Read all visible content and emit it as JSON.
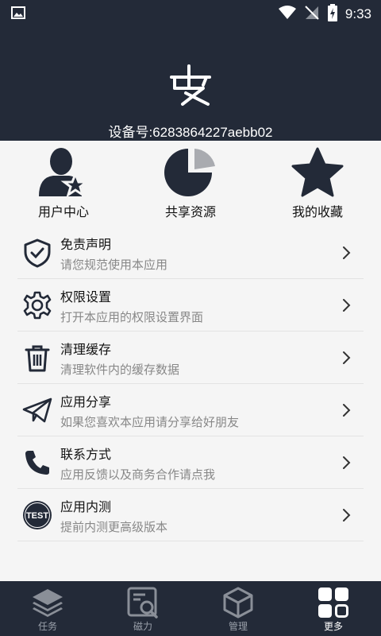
{
  "status": {
    "time": "9:33"
  },
  "header": {
    "logo_char": "皮",
    "device_id": "设备号:6283864227aebb02"
  },
  "quick": [
    {
      "label": "用户中心",
      "icon": "user-star-icon"
    },
    {
      "label": "共享资源",
      "icon": "pie-icon"
    },
    {
      "label": "我的收藏",
      "icon": "star-icon"
    }
  ],
  "menu": [
    {
      "title": "免责声明",
      "subtitle": "请您规范使用本应用",
      "icon": "shield-check-icon"
    },
    {
      "title": "权限设置",
      "subtitle": "打开本应用的权限设置界面",
      "icon": "gear-icon"
    },
    {
      "title": "清理缓存",
      "subtitle": "清理软件内的缓存数据",
      "icon": "trash-icon"
    },
    {
      "title": "应用分享",
      "subtitle": "如果您喜欢本应用请分享给好朋友",
      "icon": "send-icon"
    },
    {
      "title": "联系方式",
      "subtitle": "应用反馈以及商务合作请点我",
      "icon": "phone-icon"
    },
    {
      "title": "应用内测",
      "subtitle": "提前内测更高级版本",
      "icon": "test-badge-icon",
      "badge": "TEST"
    }
  ],
  "nav": [
    {
      "label": "任务",
      "icon": "layers-icon"
    },
    {
      "label": "磁力",
      "icon": "search-doc-icon"
    },
    {
      "label": "管理",
      "icon": "cube-icon"
    },
    {
      "label": "更多",
      "icon": "grid-icon",
      "active": true
    }
  ]
}
